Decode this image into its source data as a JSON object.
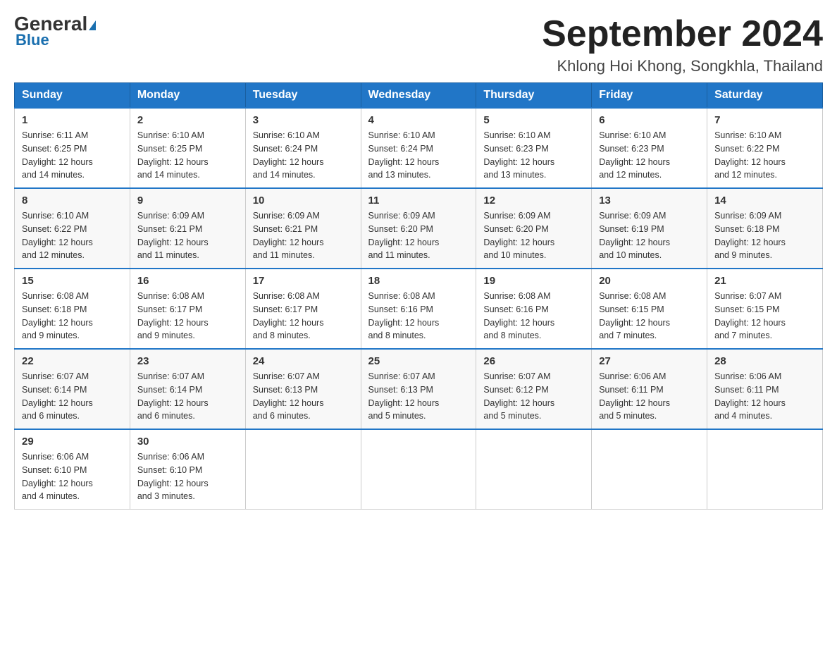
{
  "header": {
    "logo_line1": "General",
    "logo_line2": "Blue",
    "month_title": "September 2024",
    "location": "Khlong Hoi Khong, Songkhla, Thailand"
  },
  "weekdays": [
    "Sunday",
    "Monday",
    "Tuesday",
    "Wednesday",
    "Thursday",
    "Friday",
    "Saturday"
  ],
  "weeks": [
    [
      {
        "day": "1",
        "sunrise": "6:11 AM",
        "sunset": "6:25 PM",
        "daylight": "12 hours and 14 minutes."
      },
      {
        "day": "2",
        "sunrise": "6:10 AM",
        "sunset": "6:25 PM",
        "daylight": "12 hours and 14 minutes."
      },
      {
        "day": "3",
        "sunrise": "6:10 AM",
        "sunset": "6:24 PM",
        "daylight": "12 hours and 14 minutes."
      },
      {
        "day": "4",
        "sunrise": "6:10 AM",
        "sunset": "6:24 PM",
        "daylight": "12 hours and 13 minutes."
      },
      {
        "day": "5",
        "sunrise": "6:10 AM",
        "sunset": "6:23 PM",
        "daylight": "12 hours and 13 minutes."
      },
      {
        "day": "6",
        "sunrise": "6:10 AM",
        "sunset": "6:23 PM",
        "daylight": "12 hours and 12 minutes."
      },
      {
        "day": "7",
        "sunrise": "6:10 AM",
        "sunset": "6:22 PM",
        "daylight": "12 hours and 12 minutes."
      }
    ],
    [
      {
        "day": "8",
        "sunrise": "6:10 AM",
        "sunset": "6:22 PM",
        "daylight": "12 hours and 12 minutes."
      },
      {
        "day": "9",
        "sunrise": "6:09 AM",
        "sunset": "6:21 PM",
        "daylight": "12 hours and 11 minutes."
      },
      {
        "day": "10",
        "sunrise": "6:09 AM",
        "sunset": "6:21 PM",
        "daylight": "12 hours and 11 minutes."
      },
      {
        "day": "11",
        "sunrise": "6:09 AM",
        "sunset": "6:20 PM",
        "daylight": "12 hours and 11 minutes."
      },
      {
        "day": "12",
        "sunrise": "6:09 AM",
        "sunset": "6:20 PM",
        "daylight": "12 hours and 10 minutes."
      },
      {
        "day": "13",
        "sunrise": "6:09 AM",
        "sunset": "6:19 PM",
        "daylight": "12 hours and 10 minutes."
      },
      {
        "day": "14",
        "sunrise": "6:09 AM",
        "sunset": "6:18 PM",
        "daylight": "12 hours and 9 minutes."
      }
    ],
    [
      {
        "day": "15",
        "sunrise": "6:08 AM",
        "sunset": "6:18 PM",
        "daylight": "12 hours and 9 minutes."
      },
      {
        "day": "16",
        "sunrise": "6:08 AM",
        "sunset": "6:17 PM",
        "daylight": "12 hours and 9 minutes."
      },
      {
        "day": "17",
        "sunrise": "6:08 AM",
        "sunset": "6:17 PM",
        "daylight": "12 hours and 8 minutes."
      },
      {
        "day": "18",
        "sunrise": "6:08 AM",
        "sunset": "6:16 PM",
        "daylight": "12 hours and 8 minutes."
      },
      {
        "day": "19",
        "sunrise": "6:08 AM",
        "sunset": "6:16 PM",
        "daylight": "12 hours and 8 minutes."
      },
      {
        "day": "20",
        "sunrise": "6:08 AM",
        "sunset": "6:15 PM",
        "daylight": "12 hours and 7 minutes."
      },
      {
        "day": "21",
        "sunrise": "6:07 AM",
        "sunset": "6:15 PM",
        "daylight": "12 hours and 7 minutes."
      }
    ],
    [
      {
        "day": "22",
        "sunrise": "6:07 AM",
        "sunset": "6:14 PM",
        "daylight": "12 hours and 6 minutes."
      },
      {
        "day": "23",
        "sunrise": "6:07 AM",
        "sunset": "6:14 PM",
        "daylight": "12 hours and 6 minutes."
      },
      {
        "day": "24",
        "sunrise": "6:07 AM",
        "sunset": "6:13 PM",
        "daylight": "12 hours and 6 minutes."
      },
      {
        "day": "25",
        "sunrise": "6:07 AM",
        "sunset": "6:13 PM",
        "daylight": "12 hours and 5 minutes."
      },
      {
        "day": "26",
        "sunrise": "6:07 AM",
        "sunset": "6:12 PM",
        "daylight": "12 hours and 5 minutes."
      },
      {
        "day": "27",
        "sunrise": "6:06 AM",
        "sunset": "6:11 PM",
        "daylight": "12 hours and 5 minutes."
      },
      {
        "day": "28",
        "sunrise": "6:06 AM",
        "sunset": "6:11 PM",
        "daylight": "12 hours and 4 minutes."
      }
    ],
    [
      {
        "day": "29",
        "sunrise": "6:06 AM",
        "sunset": "6:10 PM",
        "daylight": "12 hours and 4 minutes."
      },
      {
        "day": "30",
        "sunrise": "6:06 AM",
        "sunset": "6:10 PM",
        "daylight": "12 hours and 3 minutes."
      },
      null,
      null,
      null,
      null,
      null
    ]
  ]
}
